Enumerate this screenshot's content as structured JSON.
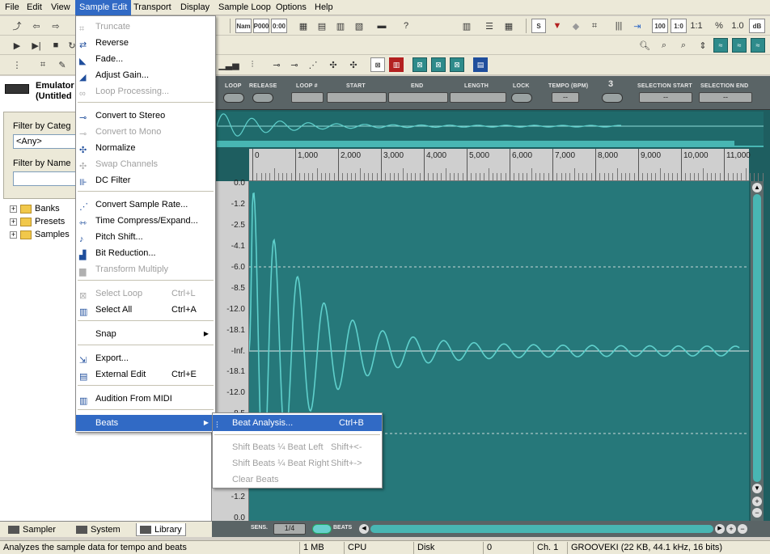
{
  "menubar": {
    "items": [
      "File",
      "Edit",
      "View",
      "Sample Edit",
      "Transport",
      "Display",
      "Sample Loop",
      "Options",
      "Help"
    ],
    "active_index": 3
  },
  "toolbar": {
    "row1_labels": [
      "Nam",
      "P000",
      "0:00"
    ],
    "zoom_labels": [
      "100",
      "1:0",
      "1:1"
    ],
    "pct_label": "%",
    "value_label": "1.0",
    "db_label": "dB"
  },
  "library": {
    "device_name": "Emulator",
    "device_sub": "(Untitled",
    "filter_category_label": "Filter by Categ",
    "filter_category_value": "<Any>",
    "filter_name_label": "Filter by Name",
    "tree": [
      "Banks",
      "Presets",
      "Samples"
    ],
    "tabs": [
      "Sampler",
      "System",
      "Library"
    ]
  },
  "params": {
    "loop": "LOOP",
    "release": "RELEASE",
    "loop_num": "LOOP #",
    "start": "START",
    "end": "END",
    "length": "LENGTH",
    "lock": "LOCK",
    "tempo": "TEMPO (BPM)",
    "tempo_value": "--",
    "selection_start": "SELECTION START",
    "selection_start_value": "--",
    "selection_end": "SELECTION END",
    "selection_end_value": "--",
    "meter_glyph": "3"
  },
  "ruler": {
    "ticks": [
      "0",
      "1,000",
      "2,000",
      "3,000",
      "4,000",
      "5,000",
      "6,000",
      "7,000",
      "8,000",
      "9,000",
      "10,000",
      "11,000"
    ]
  },
  "yaxis": {
    "labels": [
      "0.0",
      "-1.2",
      "-2.5",
      "-4.1",
      "-6.0",
      "-8.5",
      "-12.0",
      "-18.1",
      "-Inf.",
      "-18.1",
      "-12.0",
      "-8.5",
      "-6.0",
      "-4.1",
      "-2.5",
      "-1.2",
      "0.0"
    ]
  },
  "bottom_controls": {
    "sens_label": "SENS.",
    "sens_value": "1/4",
    "beats_label": "BEATS"
  },
  "sample_edit_menu": {
    "items": [
      {
        "label": "Truncate",
        "disabled": true,
        "shortcut": ""
      },
      {
        "label": "Reverse",
        "disabled": false,
        "shortcut": ""
      },
      {
        "label": "Fade...",
        "disabled": false,
        "shortcut": ""
      },
      {
        "label": "Adjust Gain...",
        "disabled": false,
        "shortcut": ""
      },
      {
        "label": "Loop Processing...",
        "disabled": true,
        "shortcut": ""
      },
      {
        "label": "Convert to Stereo",
        "disabled": false,
        "shortcut": ""
      },
      {
        "label": "Convert to Mono",
        "disabled": true,
        "shortcut": ""
      },
      {
        "label": "Normalize",
        "disabled": false,
        "shortcut": ""
      },
      {
        "label": "Swap Channels",
        "disabled": true,
        "shortcut": ""
      },
      {
        "label": "DC Filter",
        "disabled": false,
        "shortcut": ""
      },
      {
        "label": "Convert Sample Rate...",
        "disabled": false,
        "shortcut": ""
      },
      {
        "label": "Time Compress/Expand...",
        "disabled": false,
        "shortcut": ""
      },
      {
        "label": "Pitch Shift...",
        "disabled": false,
        "shortcut": ""
      },
      {
        "label": "Bit Reduction...",
        "disabled": false,
        "shortcut": ""
      },
      {
        "label": "Transform Multiply",
        "disabled": true,
        "shortcut": ""
      },
      {
        "label": "Select Loop",
        "disabled": true,
        "shortcut": "Ctrl+L"
      },
      {
        "label": "Select All",
        "disabled": false,
        "shortcut": "Ctrl+A"
      },
      {
        "label": "Snap",
        "disabled": false,
        "shortcut": ""
      },
      {
        "label": "Export...",
        "disabled": false,
        "shortcut": ""
      },
      {
        "label": "External Edit",
        "disabled": false,
        "shortcut": "Ctrl+E"
      },
      {
        "label": "Audition From MIDI",
        "disabled": false,
        "shortcut": ""
      },
      {
        "label": "Beats",
        "disabled": false,
        "shortcut": ""
      }
    ]
  },
  "beats_submenu": {
    "items": [
      {
        "label": "Beat Analysis...",
        "shortcut": "Ctrl+B",
        "disabled": false
      },
      {
        "label": "Shift Beats ¼ Beat Left",
        "shortcut": "Shift+<-",
        "disabled": true
      },
      {
        "label": "Shift Beats ¼ Beat Right",
        "shortcut": "Shift+->",
        "disabled": true
      },
      {
        "label": "Clear Beats",
        "shortcut": "",
        "disabled": true
      }
    ]
  },
  "status": {
    "message": "Analyzes the sample data for tempo and beats",
    "memory": "1 MB",
    "cpu": "CPU",
    "disk": "Disk",
    "value": "0",
    "channel": "Ch. 1",
    "sample_info": "GROOVEKI (22 KB, 44.1 kHz, 16 bits)"
  },
  "colors": {
    "waveform": "#5fd0cc",
    "wave_bg": "#26787a",
    "menu_highlight": "#316ac5"
  }
}
